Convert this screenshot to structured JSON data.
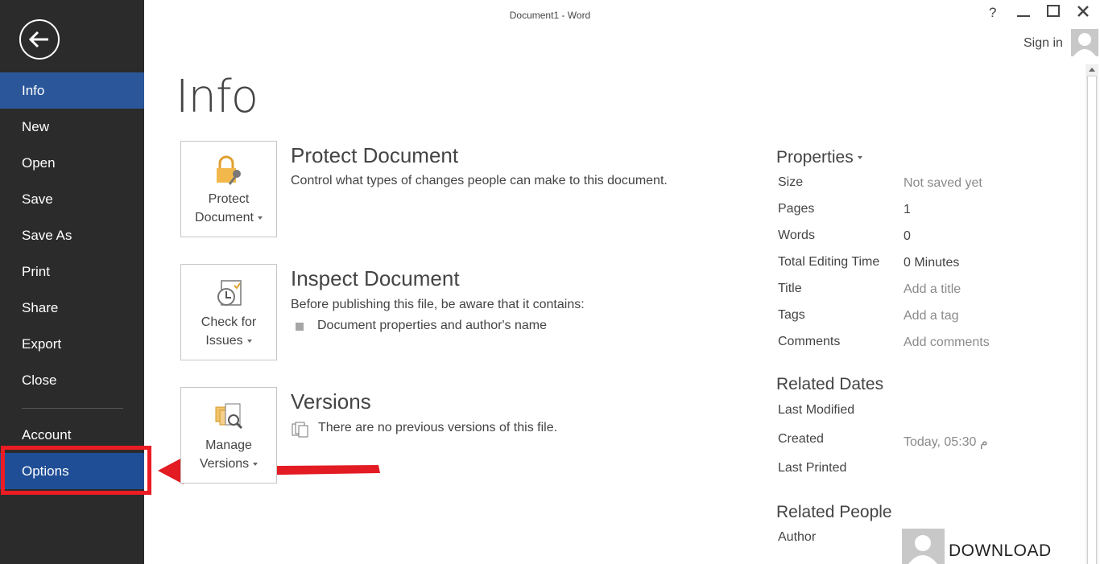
{
  "window": {
    "title": "Document1 - Word",
    "help": "?",
    "minimize": "—",
    "maximize": "☐",
    "close": "✕",
    "signin": "Sign in"
  },
  "sidebar": {
    "items": [
      {
        "label": "Info"
      },
      {
        "label": "New"
      },
      {
        "label": "Open"
      },
      {
        "label": "Save"
      },
      {
        "label": "Save As"
      },
      {
        "label": "Print"
      },
      {
        "label": "Share"
      },
      {
        "label": "Export"
      },
      {
        "label": "Close"
      },
      {
        "label": "Account"
      },
      {
        "label": "Options"
      }
    ]
  },
  "page": {
    "title": "Info"
  },
  "protect": {
    "tile_line1": "Protect",
    "tile_line2": "Document",
    "heading": "Protect Document",
    "text": "Control what types of changes people can make to this document."
  },
  "inspect": {
    "tile_line1": "Check for",
    "tile_line2": "Issues",
    "heading": "Inspect Document",
    "text": "Before publishing this file, be aware that it contains:",
    "bullet": "Document properties and author's name"
  },
  "versions": {
    "tile_line1": "Manage",
    "tile_line2": "Versions",
    "heading": "Versions",
    "text": "There are no previous versions of this file."
  },
  "properties": {
    "heading": "Properties",
    "rows": [
      {
        "key": "Size",
        "value": "Not saved yet"
      },
      {
        "key": "Pages",
        "value": "1"
      },
      {
        "key": "Words",
        "value": "0"
      },
      {
        "key": "Total Editing Time",
        "value": "0 Minutes"
      },
      {
        "key": "Title",
        "value": "Add a title"
      },
      {
        "key": "Tags",
        "value": "Add a tag"
      },
      {
        "key": "Comments",
        "value": "Add comments"
      }
    ]
  },
  "related_dates": {
    "heading": "Related Dates",
    "last_modified": "Last Modified",
    "created": "Created",
    "created_value": "Today, 05:30 م",
    "last_printed": "Last Printed"
  },
  "related_people": {
    "heading": "Related People",
    "author": "Author",
    "watermark": "DOWNLOAD"
  },
  "colors": {
    "sidebar": "#2b2b2b",
    "active": "#2b579a",
    "highlight": "#ec1c24"
  }
}
